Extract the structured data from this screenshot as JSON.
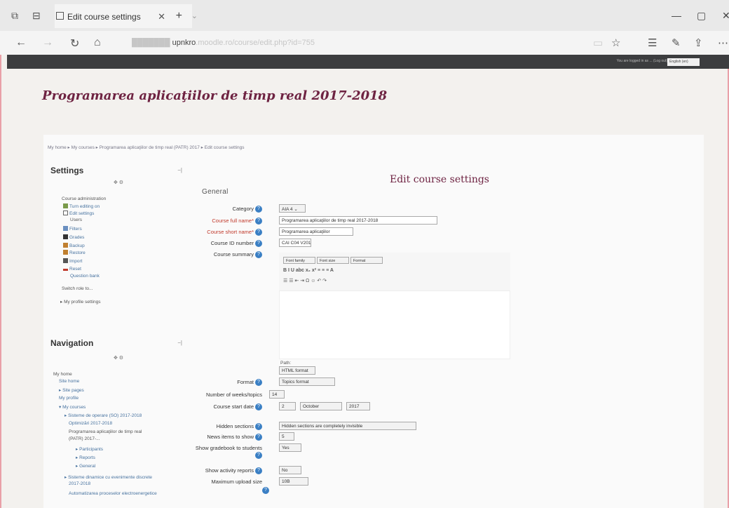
{
  "browser": {
    "tab_title": "Edit course settings",
    "url_visible": "upnkro",
    "url_blurred": ".moodle.ro/course/edit.php?id=755"
  },
  "header": {
    "login_text": "You are logged in as ... (Log out)",
    "language": "English (en)"
  },
  "page": {
    "title": "Programarea aplicaţiilor de timp real 2017-2018",
    "breadcrumb": [
      "My home",
      "My courses",
      "Programarea aplicaţiilor de timp real (PATR) 2017",
      "Edit course settings"
    ]
  },
  "settings_block": {
    "title": "Settings",
    "section": "Course administration",
    "items": [
      {
        "label": "Turn editing on",
        "link": true
      },
      {
        "label": "Edit settings",
        "link": true
      },
      {
        "label": "Users",
        "link": false
      },
      {
        "label": "Filters",
        "link": true
      },
      {
        "label": "Grades",
        "link": true
      },
      {
        "label": "Backup",
        "link": true
      },
      {
        "label": "Restore",
        "link": true
      },
      {
        "label": "Import",
        "link": true
      },
      {
        "label": "Reset",
        "link": true
      },
      {
        "label": "Question bank",
        "link": true
      }
    ],
    "switch_role": "Switch role to...",
    "profile_settings": "My profile settings"
  },
  "navigation_block": {
    "title": "Navigation",
    "items": [
      {
        "label": "My home",
        "link": false
      },
      {
        "label": "Site home",
        "link": true
      },
      {
        "label": "Site pages",
        "link": true
      },
      {
        "label": "My profile",
        "link": true
      },
      {
        "label": "My courses",
        "link": true
      },
      {
        "label": "Sisteme de operare (SO) 2017-2018",
        "link": true
      },
      {
        "label": "Optimizări 2017-2018",
        "link": true
      },
      {
        "label": "Programarea aplicaţiilor de timp real",
        "link": false
      },
      {
        "label": "(PATR) 2017-...",
        "link": false
      },
      {
        "label": "Participants",
        "link": true
      },
      {
        "label": "Reports",
        "link": true
      },
      {
        "label": "General",
        "link": true
      },
      {
        "label": "Sisteme dinamice cu evenimente discrete",
        "link": true
      },
      {
        "label": "2017-2018",
        "link": true
      },
      {
        "label": "Automatizarea proceselor electroenergetice",
        "link": true
      }
    ]
  },
  "form": {
    "heading": "Edit course settings",
    "legend": "General",
    "category_label": "Category",
    "category_value": "AIA 4",
    "fullname_label": "Course full name",
    "fullname_value": "Programarea aplicaţiilor de timp real 2017-2018",
    "shortname_label": "Course short name",
    "shortname_value": "Programarea aplicaţiilor",
    "idnumber_label": "Course ID number",
    "idnumber_value": "CAI C04 V2017",
    "summary_label": "Course summary",
    "editor_row1": [
      "Font family",
      "Font size",
      "Format"
    ],
    "editor_row2": "B  I  U  abc  x₂  x²  ≡  ≡  ≡   A  ",
    "editor_row3": "☰  ☰  ⇤  ⇥   Ω  ☺  ↶  ↷",
    "path_label": "Path:",
    "text_format": "HTML format",
    "format_label": "Format",
    "format_value": "Topics format",
    "numsections_label": "Number of weeks/topics",
    "numsections_value": "14",
    "startdate_label": "Course start date",
    "startdate_day": "2",
    "startdate_month": "October",
    "startdate_year": "2017",
    "hidden_label": "Hidden sections",
    "hidden_value": "Hidden sections are completely invisible",
    "news_label": "News items to show",
    "news_value": "5",
    "gradebook_label": "Show gradebook to students",
    "gradebook_value": "Yes",
    "reports_label": "Show activity reports",
    "reports_value": "No",
    "upload_label": "Maximum upload size",
    "upload_value": "10B"
  }
}
